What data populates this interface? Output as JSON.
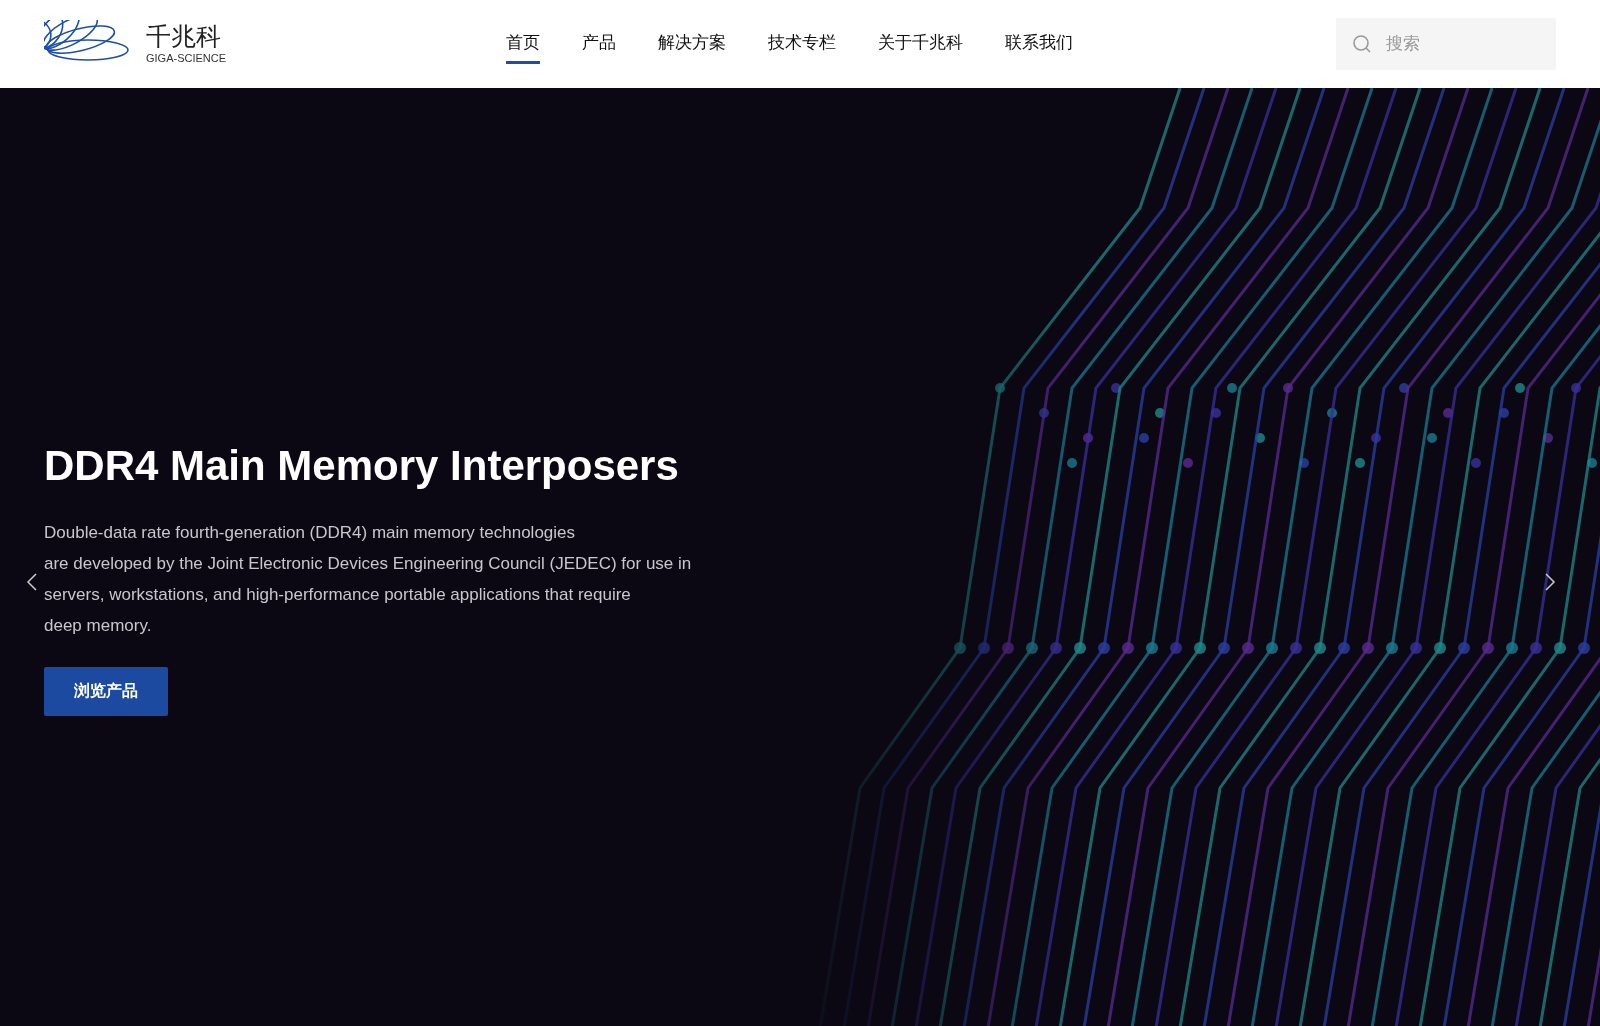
{
  "header": {
    "logo": {
      "name": "千兆科",
      "subtitle": "GIGA-SCIENCE"
    },
    "nav": [
      {
        "label": "首页",
        "selected": true
      },
      {
        "label": "产品",
        "selected": false
      },
      {
        "label": "解决方案",
        "selected": false
      },
      {
        "label": "技术专栏",
        "selected": false
      },
      {
        "label": "关于千兆科",
        "selected": false
      },
      {
        "label": "联系我们",
        "selected": false
      }
    ],
    "search": {
      "placeholder": "搜索"
    }
  },
  "hero": {
    "title": "DDR4 Main Memory Interposers",
    "description_lines": [
      "Double-data rate fourth-generation (DDR4) main memory technologies",
      "are developed by the Joint Electronic Devices Engineering Council (JEDEC) for use in",
      "servers, workstations, and high-performance portable applications that require",
      "deep memory."
    ],
    "button": "浏览产品"
  }
}
